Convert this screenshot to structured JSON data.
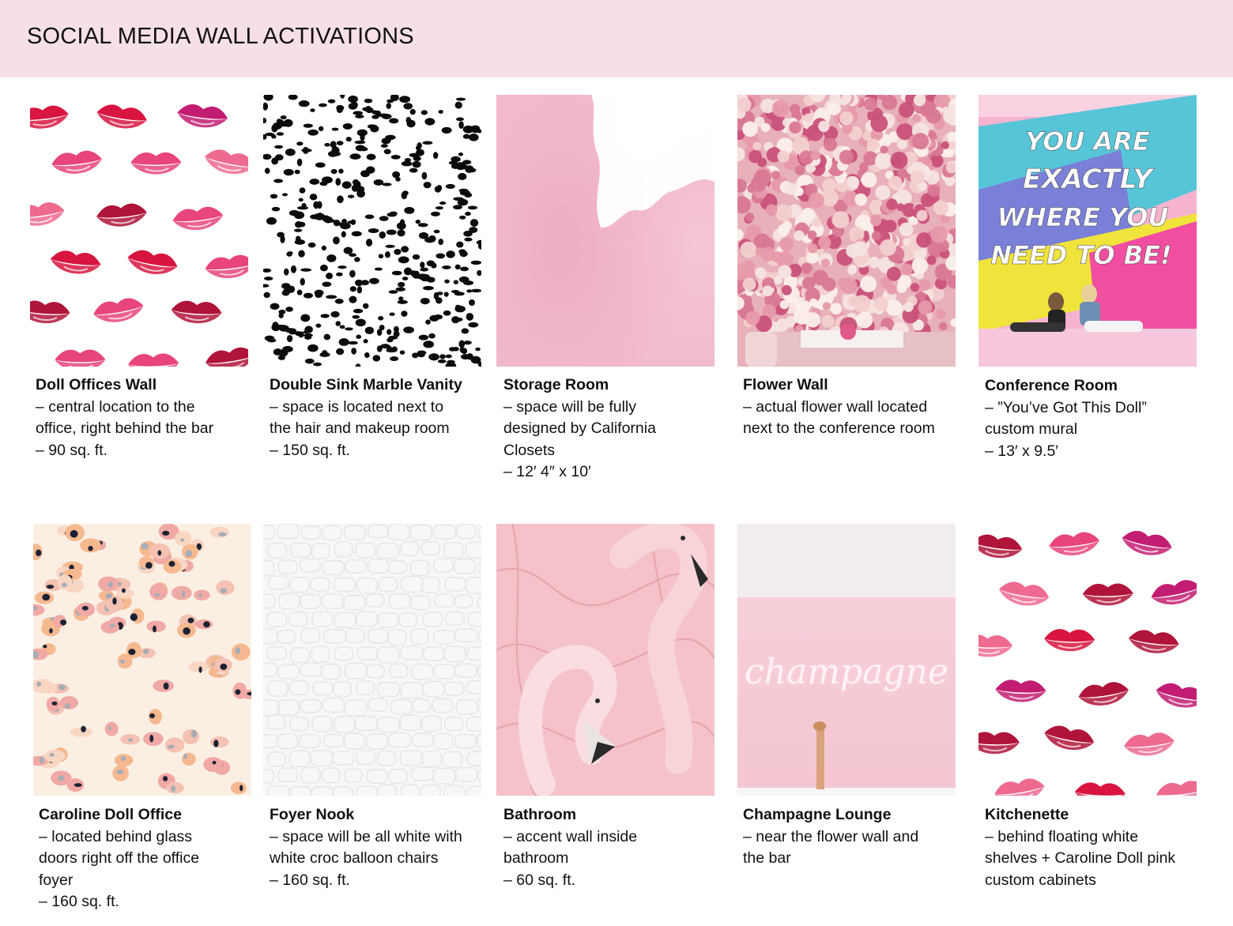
{
  "header": {
    "title": "SOCIAL MEDIA WALL ACTIVATIONS"
  },
  "images": {
    "conference_mural_text": [
      "YOU ARE",
      "EXACTLY",
      "WHERE YOU",
      "NEED TO BE!"
    ],
    "neon_text": "champagne"
  },
  "colors": {
    "header_bg": "#f6e0e6",
    "lips_red": "#d8153f",
    "lips_magenta": "#c21d72",
    "blush": "#f4c3d1",
    "neon_glow": "#ffe3ec"
  },
  "cards": [
    {
      "title": "Doll Offices Wall",
      "lines": [
        "– central location to the",
        "office, right behind the bar",
        "– 90 sq. ft."
      ]
    },
    {
      "title": "Double Sink Marble Vanity",
      "lines": [
        "– space is located next to",
        "the hair and makeup room",
        "– 150 sq. ft."
      ]
    },
    {
      "title": "Storage Room",
      "lines": [
        "– space will be fully",
        "designed by California",
        "Closets",
        "– 12′ 4″ x 10′"
      ]
    },
    {
      "title": "Flower Wall",
      "lines": [
        "– actual flower wall located",
        "next to the conference room"
      ]
    },
    {
      "title": "Conference Room",
      "lines": [
        "– ”You’ve Got This Doll”",
        "custom mural",
        "– 13′ x 9.5′"
      ]
    },
    {
      "title": "Caroline Doll Office",
      "lines": [
        "– located behind glass",
        "doors right off the office",
        "foyer",
        "– 160 sq. ft."
      ]
    },
    {
      "title": "Foyer Nook",
      "lines": [
        "– space will be all white with",
        "white croc balloon chairs",
        "– 160 sq. ft."
      ]
    },
    {
      "title": "Bathroom",
      "lines": [
        "– accent wall inside",
        "bathroom",
        "– 60 sq. ft."
      ]
    },
    {
      "title": "Champagne Lounge",
      "lines": [
        "– near the flower wall and",
        "the bar"
      ]
    },
    {
      "title": "Kitchenette",
      "lines": [
        "– behind floating white",
        "shelves + Caroline Doll pink",
        "custom cabinets"
      ]
    }
  ]
}
